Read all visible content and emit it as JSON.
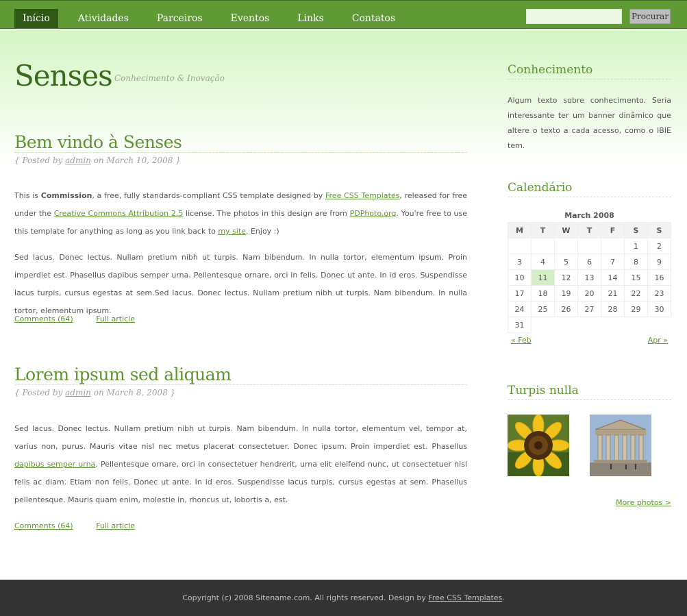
{
  "menu": {
    "items": [
      "Início",
      "Atividades",
      "Parceiros",
      "Eventos",
      "Links",
      "Contatos"
    ]
  },
  "search": {
    "button_label": "Procurar",
    "value": ""
  },
  "logo": {
    "title": "Senses",
    "slogan": "Conhecimento & Inovação"
  },
  "posts": [
    {
      "title": "Bem vindo à Senses",
      "byline_pre": "{ Posted by ",
      "author": "admin",
      "byline_post": " on March 10, 2008 }",
      "p1": {
        "t1": "This is ",
        "bold": "Commission",
        "t2": ", a free, fully standards-compliant CSS template designed by ",
        "link1": "Free CSS Templates",
        "t3": ", released for free under the ",
        "link2": "Creative Commons Attribution 2.5",
        "t4": " license. The photos in this design are from ",
        "link3": "PDPhoto.org",
        "t5": ". You're free to use this template for anything as long as you link back to ",
        "link4": "my site",
        "t6": ". Enjoy :)"
      },
      "p2": "Sed lacus. Donec lectus. Nullam pretium nibh ut turpis. Nam bibendum. In nulla tortor, elementum ipsum. Proin imperdiet est. Phasellus dapibus semper urna. Pellentesque ornare, orci in felis. Donec ut ante. In id eros. Suspendisse lacus turpis, cursus egestas at sem.Sed lacus. Donec lectus. Nullam pretium nibh ut turpis. Nam bibendum. In nulla tortor, elementum ipsum.",
      "comments": "Comments (64)",
      "full": "Full article"
    },
    {
      "title": "Lorem ipsum sed aliquam",
      "byline_pre": "{ Posted by ",
      "author": "admin",
      "byline_post": " on March 8, 2008 }",
      "p1": {
        "t1": "Sed lacus. Donec lectus. Nullam pretium nibh ut turpis. Nam bibendum. In nulla tortor, elementum vel, tempor at, varius non, purus. Mauris vitae nisl nec metus placerat consectetuer. Donec ipsum. Proin imperdiet est. Phasellus ",
        "link1": "dapibus semper urna",
        "t2": ". Pellentesque ornare, orci in consectetuer hendrerit, urna elit eleifend nunc, ut consectetuer nisl felis ac diam. Etiam non felis. Donec ut ante. In id eros. Suspendisse lacus turpis, cursus egestas at sem. Phasellus pellentesque. Mauris quam enim, molestie in, rhoncus ut, lobortis a, est."
      },
      "comments": "Comments (64)",
      "full": "Full article"
    }
  ],
  "sidebar": {
    "conhecimento": {
      "title": "Conhecimento",
      "text": "Algum texto sobre conhecimento. Seria interessante ter um banner dinâmico que altere o texto a cada acesso, como o IBIE tem."
    },
    "calendar": {
      "title": "Calendário",
      "caption": "March 2008",
      "days": [
        "M",
        "T",
        "W",
        "T",
        "F",
        "S",
        "S"
      ],
      "weeks": [
        [
          "",
          "",
          "",
          "",
          "",
          "1",
          "2"
        ],
        [
          "3",
          "4",
          "5",
          "6",
          "7",
          "8",
          "9"
        ],
        [
          "10",
          "11",
          "12",
          "13",
          "14",
          "15",
          "16"
        ],
        [
          "17",
          "18",
          "19",
          "20",
          "21",
          "22",
          "23"
        ],
        [
          "24",
          "25",
          "26",
          "27",
          "28",
          "29",
          "30"
        ],
        [
          "31",
          "",
          "",
          "",
          "",
          "",
          ""
        ]
      ],
      "today": "11",
      "prev": "« Feb",
      "next": "Apr »"
    },
    "photos": {
      "title": "Turpis nulla",
      "more": "More photos >"
    }
  },
  "footer": {
    "text": "Copyright (c) 2008 Sitename.com. All rights reserved. Design by ",
    "link": "Free CSS Templates",
    "end": "."
  },
  "colors": {
    "menu_bar": "#5f9a35",
    "menu_active": "#2f5915",
    "accent_green": "#5e9532",
    "logo_green": "#3b6b1d",
    "footer": "#333333"
  }
}
